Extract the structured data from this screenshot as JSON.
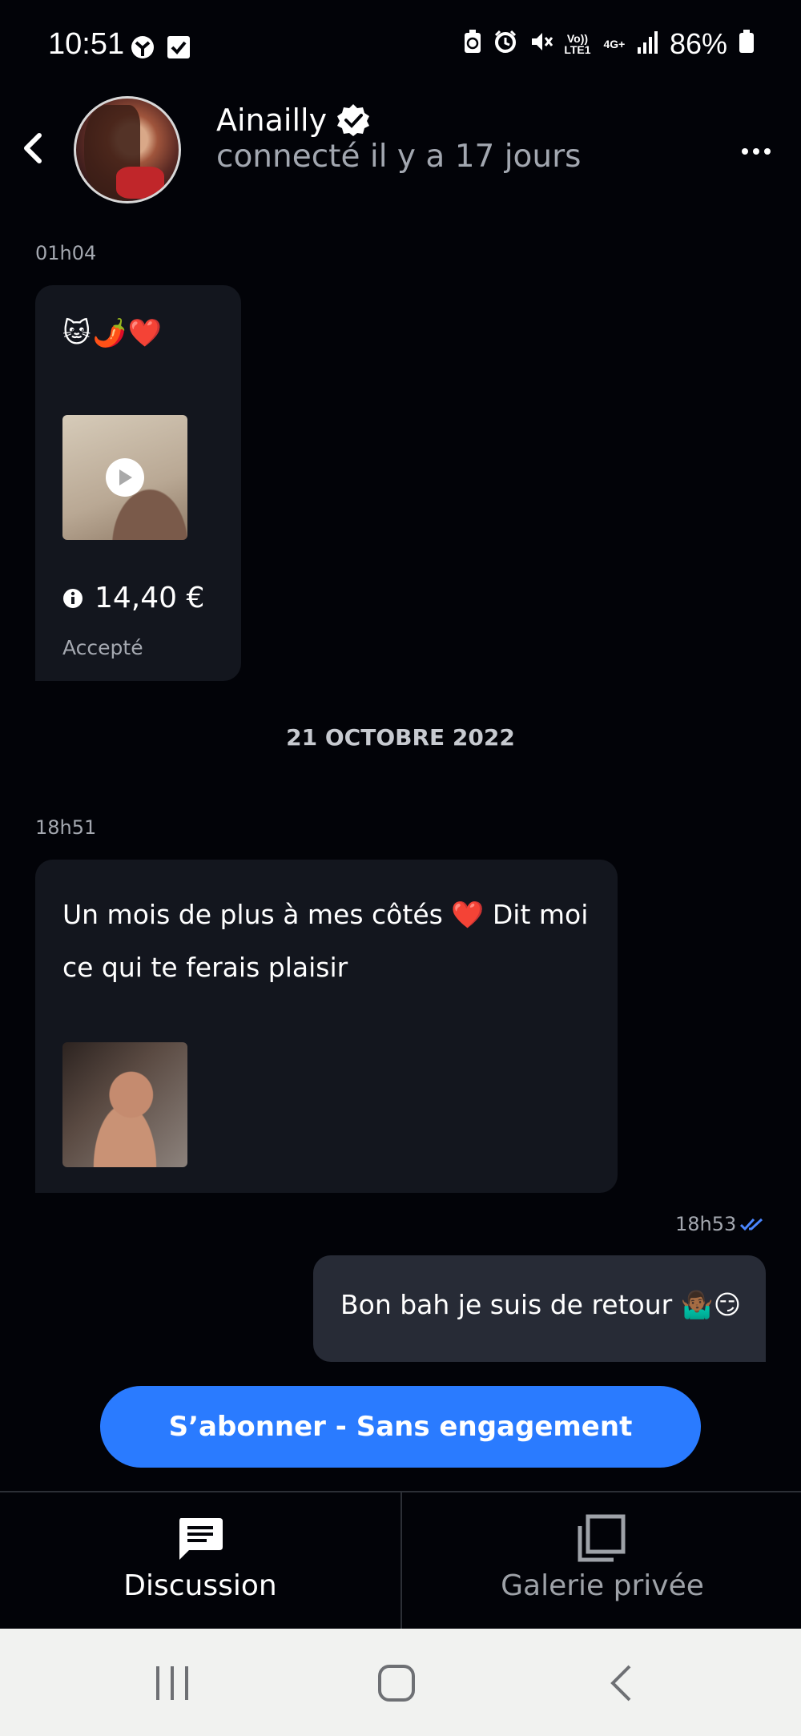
{
  "status_bar": {
    "time": "10:51",
    "battery": "86%",
    "network_top": "Vo)) LTE1",
    "network_gen": "4G+"
  },
  "header": {
    "name": "Ainailly",
    "last_seen": "connecté il y a 17 jours",
    "icons": [
      "back-arrow-icon",
      "verified-badge-icon",
      "more-icon"
    ]
  },
  "messages": [
    {
      "time": "01h04",
      "emojis": [
        "🐱",
        "🌶️",
        "❤️"
      ],
      "price": "14,40 €",
      "status": "Accepté"
    },
    {
      "date_separator": "21 OCTOBRE 2022"
    },
    {
      "time": "18h51",
      "text": "Un mois de plus à mes côtés ❤️ Dit moi ce qui te ferais plaisir"
    },
    {
      "time": "18h53",
      "text": "Bon bah je suis de retour 🤷🏾‍♂️😏"
    }
  ],
  "subscribe": {
    "label": "S’abonner - Sans engagement"
  },
  "tabs": [
    {
      "label": "Discussion",
      "icon": "chat-icon",
      "active": true
    },
    {
      "label": "Galerie privée",
      "icon": "gallery-icon",
      "active": false
    }
  ],
  "colors": {
    "background": "#020308",
    "bubble_in": "#13161e",
    "bubble_out": "#272b36",
    "accent": "#2a7bff",
    "read_ticks": "#4a86ff"
  }
}
